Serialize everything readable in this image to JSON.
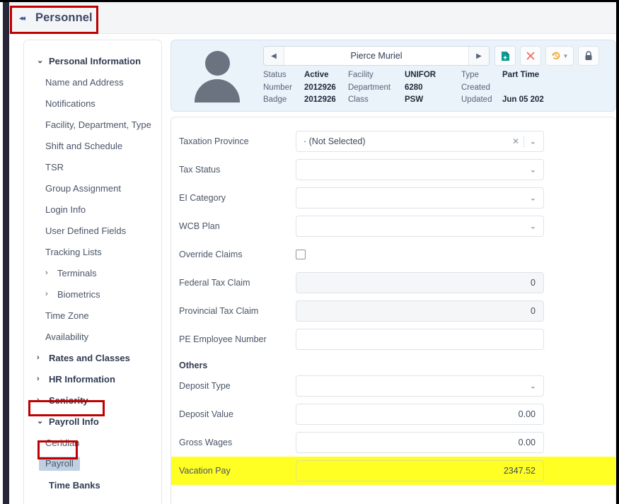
{
  "topbar": {
    "collapse_icon": "◂◂",
    "title": "Personnel"
  },
  "sidebar": {
    "items": [
      {
        "label": "Personal Information",
        "type": "group",
        "caret": "⌄",
        "selected": false
      },
      {
        "label": "Name and Address",
        "type": "item",
        "caret": "",
        "selected": false
      },
      {
        "label": "Notifications",
        "type": "item",
        "caret": "",
        "selected": false
      },
      {
        "label": "Facility, Department, Type",
        "type": "item",
        "caret": "",
        "selected": false
      },
      {
        "label": "Shift and Schedule",
        "type": "item",
        "caret": "",
        "selected": false
      },
      {
        "label": "TSR",
        "type": "item",
        "caret": "",
        "selected": false
      },
      {
        "label": "Group Assignment",
        "type": "item",
        "caret": "",
        "selected": false
      },
      {
        "label": "Login Info",
        "type": "item",
        "caret": "",
        "selected": false
      },
      {
        "label": "User Defined Fields",
        "type": "item",
        "caret": "",
        "selected": false
      },
      {
        "label": "Tracking Lists",
        "type": "item",
        "caret": "",
        "selected": false
      },
      {
        "label": "Terminals",
        "type": "sub-group",
        "caret": "›",
        "selected": false
      },
      {
        "label": "Biometrics",
        "type": "sub-group",
        "caret": "›",
        "selected": false
      },
      {
        "label": "Time Zone",
        "type": "item",
        "caret": "",
        "selected": false
      },
      {
        "label": "Availability",
        "type": "item",
        "caret": "",
        "selected": false
      },
      {
        "label": "Rates and Classes",
        "type": "group",
        "caret": "›",
        "selected": false
      },
      {
        "label": "HR Information",
        "type": "group",
        "caret": "›",
        "selected": false
      },
      {
        "label": "Seniority",
        "type": "group",
        "caret": "›",
        "selected": false
      },
      {
        "label": "Payroll Info",
        "type": "group",
        "caret": "⌄",
        "selected": false
      },
      {
        "label": "Ceridian",
        "type": "item",
        "caret": "",
        "selected": false
      },
      {
        "label": "Payroll",
        "type": "item",
        "caret": "",
        "selected": true
      },
      {
        "label": "Time Banks",
        "type": "group",
        "caret": "",
        "selected": false
      }
    ]
  },
  "employee_header": {
    "avatar_icon": "person-avatar-icon",
    "prev_label": "◀",
    "next_label": "▶",
    "name": "Pierce Muriel",
    "toolbar": [
      {
        "name": "new-document-button",
        "glyph": "document-add-icon"
      },
      {
        "name": "delete-button",
        "glyph": "close-x-icon"
      },
      {
        "name": "history-button",
        "glyph": "history-undo-icon"
      },
      {
        "name": "lock-button",
        "glyph": "lock-icon"
      }
    ],
    "meta": {
      "col1": [
        {
          "label": "Status",
          "value": "Active"
        },
        {
          "label": "Number",
          "value": "2012926"
        },
        {
          "label": "Badge",
          "value": "2012926"
        }
      ],
      "col2": [
        {
          "label": "Facility",
          "value": "UNIFOR"
        },
        {
          "label": "Department",
          "value": "6280"
        },
        {
          "label": "Class",
          "value": "PSW"
        }
      ],
      "col3": [
        {
          "label": "Type",
          "value": "Part Time"
        },
        {
          "label": "Created",
          "value": ""
        },
        {
          "label": "Updated",
          "value": "Jun 05 202"
        }
      ]
    }
  },
  "form": {
    "rows": [
      {
        "label": "Taxation Province",
        "control": "select-clearable",
        "value": "· (Not Selected)",
        "clear": "✕",
        "chevron": "⌄"
      },
      {
        "label": "Tax Status",
        "control": "select",
        "value": "",
        "chevron": "⌄"
      },
      {
        "label": "EI Category",
        "control": "select",
        "value": "",
        "chevron": "⌄"
      },
      {
        "label": "WCB Plan",
        "control": "select",
        "value": "",
        "chevron": "⌄"
      },
      {
        "label": "Override Claims",
        "control": "checkbox",
        "value": ""
      },
      {
        "label": "Federal Tax Claim",
        "control": "input-readonly",
        "value": "0"
      },
      {
        "label": "Provincial Tax Claim",
        "control": "input-readonly",
        "value": "0"
      },
      {
        "label": "PE Employee Number",
        "control": "input",
        "value": ""
      }
    ],
    "section_others": "Others",
    "others_rows": [
      {
        "label": "Deposit Type",
        "control": "select",
        "value": "",
        "chevron": "⌄"
      },
      {
        "label": "Deposit Value",
        "control": "input",
        "value": "0.00"
      },
      {
        "label": "Gross Wages",
        "control": "input",
        "value": "0.00"
      },
      {
        "label": "Vacation Pay",
        "control": "input",
        "value": "2347.52",
        "highlight": true
      }
    ]
  },
  "colors": {
    "highlight_yellow": "#ffff24",
    "annotation_red": "#c00000",
    "selected_nav": "#bed0e2",
    "header_blue": "#eaf2fa",
    "rail_dark": "#272639"
  }
}
